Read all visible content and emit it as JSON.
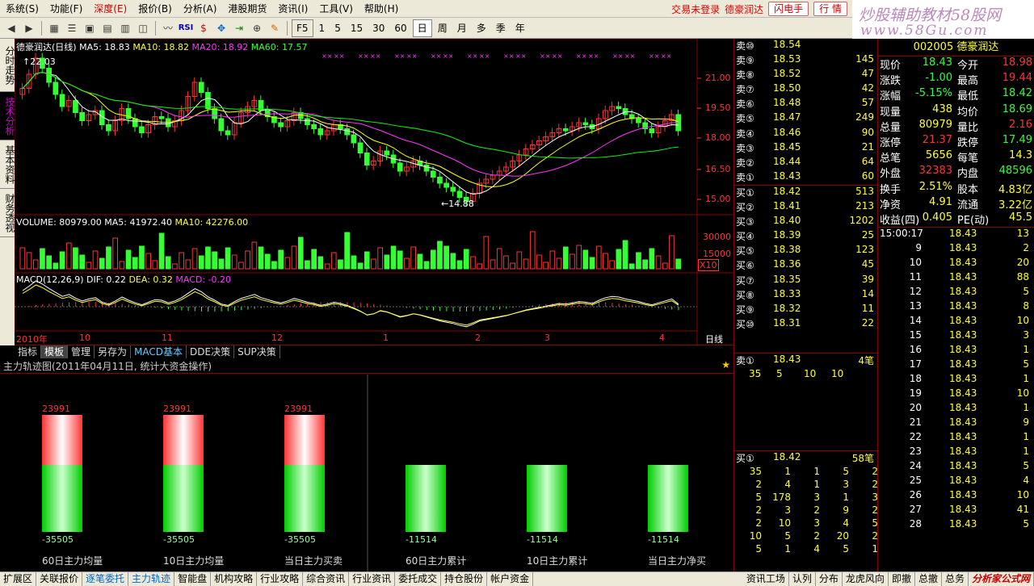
{
  "menu": {
    "items": [
      "系统(S)",
      "功能(F)",
      "深度(E)",
      "报价(B)",
      "分析(A)",
      "港股期货",
      "资讯(I)",
      "工具(V)",
      "帮助(H)"
    ],
    "warning": "交易未登录",
    "stock_name": "德豪润达",
    "btn_flash": "闪电手",
    "btn_market": "行 情"
  },
  "watermark": {
    "line1": "炒股辅助教材58股网",
    "line2": "www.58Gu.com"
  },
  "toolbar": {
    "periods": [
      "F5",
      "1",
      "5",
      "15",
      "30",
      "60",
      "日",
      "周",
      "月",
      "多",
      "季",
      "年"
    ],
    "selected": "日"
  },
  "side_tabs": [
    "分时走势",
    "技术分析",
    "基本资料",
    "财务透视"
  ],
  "chart": {
    "title": "德豪润达(日线)",
    "ma5": "MA5: 18.83",
    "ma10": "MA10: 18.82",
    "ma20": "MA20: 18.92",
    "ma60": "MA60: 17.57",
    "price_ticks": [
      "21.00",
      "19.50",
      "18.00",
      "16.50",
      "15.00"
    ],
    "high_label": "22.03",
    "low_label": "14.88",
    "vol_title": "VOLUME: 80979.00",
    "vol_ma5": "MA5: 41972.40",
    "vol_ma10": "MA10: 42276.00",
    "vol_ticks": [
      "30000",
      "15000"
    ],
    "vol_unit": "X10",
    "macd_title": "MACD(12,26,9)",
    "macd_dif": "DIF: 0.22",
    "macd_dea": "DEA: 0.32",
    "macd_val": "MACD: -0.20",
    "date_labels": [
      "2010年",
      "10",
      "11",
      "12",
      "1",
      "2",
      "3",
      "4"
    ],
    "period_label": "日线",
    "colors": {
      "up": "#ff3333",
      "down": "#33ff33",
      "ma5": "#ffffff",
      "ma10": "#ffff00",
      "ma20": "#ff33ff",
      "ma60": "#00ff00"
    }
  },
  "subtabs": [
    "指标",
    "模板",
    "管理",
    "另存为",
    "MACD基本",
    "DDE决策",
    "SUP决策"
  ],
  "mainforce": {
    "title": "主力轨迹图(2011年04月11日, 统计大资金操作)",
    "bars": [
      {
        "label": "60日主力均量",
        "top": "23991",
        "bottom": "-35505",
        "has_top": true
      },
      {
        "label": "10日主力均量",
        "top": "23991",
        "bottom": "-35505",
        "has_top": true
      },
      {
        "label": "当日主力买卖",
        "top": "23991",
        "bottom": "-35505",
        "has_top": true
      },
      {
        "label": "60日主力累计",
        "top": "",
        "bottom": "-11514",
        "has_top": false
      },
      {
        "label": "10日主力累计",
        "top": "",
        "bottom": "-11514",
        "has_top": false
      },
      {
        "label": "当日主力净买",
        "top": "",
        "bottom": "-11514",
        "has_top": false
      }
    ]
  },
  "orderbook": {
    "asks": [
      {
        "l": "卖⑩",
        "p": "18.54",
        "v": ""
      },
      {
        "l": "卖⑨",
        "p": "18.53",
        "v": "145"
      },
      {
        "l": "卖⑧",
        "p": "18.52",
        "v": "47"
      },
      {
        "l": "卖⑦",
        "p": "18.50",
        "v": "42"
      },
      {
        "l": "卖⑥",
        "p": "18.48",
        "v": "57"
      },
      {
        "l": "卖⑤",
        "p": "18.47",
        "v": "249"
      },
      {
        "l": "卖④",
        "p": "18.46",
        "v": "90"
      },
      {
        "l": "卖③",
        "p": "18.45",
        "v": "21"
      },
      {
        "l": "卖②",
        "p": "18.44",
        "v": "64"
      },
      {
        "l": "卖①",
        "p": "18.43",
        "v": "60"
      }
    ],
    "bids": [
      {
        "l": "买①",
        "p": "18.42",
        "v": "513"
      },
      {
        "l": "买②",
        "p": "18.41",
        "v": "213"
      },
      {
        "l": "买③",
        "p": "18.40",
        "v": "1202"
      },
      {
        "l": "买④",
        "p": "18.39",
        "v": "25"
      },
      {
        "l": "买⑤",
        "p": "18.38",
        "v": "123"
      },
      {
        "l": "买⑥",
        "p": "18.36",
        "v": "45"
      },
      {
        "l": "买⑦",
        "p": "18.35",
        "v": "39"
      },
      {
        "l": "买⑧",
        "p": "18.33",
        "v": "14"
      },
      {
        "l": "买⑨",
        "p": "18.32",
        "v": "11"
      },
      {
        "l": "买⑩",
        "p": "18.31",
        "v": "22"
      }
    ],
    "sell1_head": {
      "l": "卖①",
      "p": "18.43",
      "v": "4笔"
    },
    "sell1_queue": [
      "35",
      "5",
      "10",
      "10"
    ],
    "buy1_head": {
      "l": "买①",
      "p": "18.42",
      "v": "58笔"
    },
    "buy1_queue": [
      [
        "35",
        "1",
        "1",
        "5",
        "2"
      ],
      [
        "2",
        "4",
        "1",
        "3",
        "2"
      ],
      [
        "5",
        "178",
        "3",
        "1",
        "3"
      ],
      [
        "2",
        "3",
        "2",
        "9",
        "2"
      ],
      [
        "2",
        "10",
        "3",
        "4",
        "5"
      ],
      [
        "10",
        "5",
        "2",
        "20",
        "2"
      ],
      [
        "5",
        "1",
        "4",
        "5",
        "1"
      ]
    ]
  },
  "quote": {
    "code": "002005",
    "name": "德豪润达",
    "rows": [
      [
        "现价",
        "18.43",
        "今开",
        "18.98"
      ],
      [
        "涨跌",
        "-1.00",
        "最高",
        "19.44"
      ],
      [
        "涨幅",
        "-5.15%",
        "最低",
        "18.42"
      ],
      [
        "现量",
        "438",
        "均价",
        "18.69"
      ],
      [
        "总量",
        "80979",
        "量比",
        "2.16"
      ],
      [
        "涨停",
        "21.37",
        "跌停",
        "17.49"
      ],
      [
        "总笔",
        "5656",
        "每笔",
        "14.3"
      ],
      [
        "外盘",
        "32383",
        "内盘",
        "48596"
      ],
      [
        "换手",
        "2.51%",
        "股本",
        "4.83亿"
      ],
      [
        "净资",
        "4.91",
        "流通",
        "3.22亿"
      ],
      [
        "收益(四)",
        "0.405",
        "PE(动)",
        "45.5"
      ]
    ],
    "ticks": [
      [
        "15:00:17",
        "18.43",
        "13"
      ],
      [
        "9",
        "18.43",
        "2"
      ],
      [
        "10",
        "18.43",
        "20"
      ],
      [
        "11",
        "18.43",
        "88"
      ],
      [
        "12",
        "18.43",
        "5"
      ],
      [
        "13",
        "18.43",
        "8"
      ],
      [
        "14",
        "18.43",
        "10"
      ],
      [
        "15",
        "18.43",
        "3"
      ],
      [
        "16",
        "18.43",
        "1"
      ],
      [
        "17",
        "18.43",
        "5"
      ],
      [
        "18",
        "18.43",
        "1"
      ],
      [
        "19",
        "18.43",
        "10"
      ],
      [
        "20",
        "18.43",
        "1"
      ],
      [
        "21",
        "18.43",
        "9"
      ],
      [
        "22",
        "18.43",
        "1"
      ],
      [
        "23",
        "18.43",
        "1"
      ],
      [
        "24",
        "18.43",
        "5"
      ],
      [
        "25",
        "18.43",
        "4"
      ],
      [
        "26",
        "18.43",
        "10"
      ],
      [
        "27",
        "18.43",
        "41"
      ],
      [
        "28",
        "18.43",
        "5"
      ]
    ]
  },
  "bottombar": [
    "扩展区",
    "关联报价",
    "逐笔委托",
    "主力轨迹",
    "智能盘",
    "机构攻略",
    "行业攻略",
    "综合资讯",
    "行业资讯",
    "委托成交",
    "持仓股份",
    "帐户资金"
  ],
  "bottom_right": [
    "资讯工场",
    "认列",
    "分布",
    "龙虎风向",
    "即撤",
    "总撤",
    "总务"
  ],
  "logo": "分析家公式网"
}
